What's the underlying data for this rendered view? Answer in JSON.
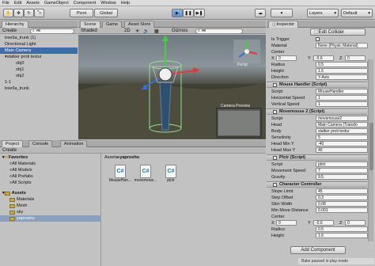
{
  "menu": [
    "File",
    "Edit",
    "Assets",
    "GameObject",
    "Component",
    "Window",
    "Help"
  ],
  "toolbar": {
    "pivot": "Pivot",
    "global": "Global",
    "layers": "Layers",
    "layout": "Default"
  },
  "hierarchy": {
    "tab": "Hierarchy",
    "create": "Create",
    "search": "All",
    "items": [
      "tree5a_trunk (1)",
      "Directional Light",
      "Main Camera",
      "stalker proti textur",
      "obj0",
      "obj1",
      "obj2",
      "1-1",
      "tree5a_trunk"
    ]
  },
  "scene": {
    "tab_scene": "Scene",
    "tab_game": "Game",
    "tab_asset": "Asset Store",
    "shaded": "Shaded",
    "mode2d": "2D",
    "gizmos": "Gizmos",
    "search": "All",
    "persp": "Persp",
    "preview_label": "Camera Preview"
  },
  "project": {
    "tab_project": "Project",
    "tab_console": "Console",
    "tab_animation": "Animation",
    "create": "Create",
    "favorites_label": "Favorites",
    "favorites": [
      "All Materials",
      "All Models",
      "All Prefabs",
      "All Scripts"
    ],
    "assets_label": "Assets",
    "folders": [
      "Materials",
      "Mesh",
      "sky",
      "yaproshu"
    ],
    "breadcrumb_root": "Assets",
    "breadcrumb_current": "yaproshu",
    "files": [
      "MouseHan...",
      "movemous...",
      "plctr"
    ]
  },
  "inspector": {
    "tab": "Inspector",
    "collider": {
      "edit_label": "Edit Collider",
      "is_trigger": "Is Trigger",
      "material_label": "Material",
      "material_value": "None (Physic Material)",
      "center_label": "Center",
      "x": "0",
      "y": "-0.6",
      "z": "0",
      "radius_label": "Radius",
      "radius": "0.5",
      "height_label": "Height",
      "height": "1.6",
      "direction_label": "Direction",
      "direction": "Y-Axis"
    },
    "mouse_handler": {
      "title": "Mouse Handler (Script)",
      "script_label": "Script",
      "script": "MouseHandler",
      "hspeed_label": "Horizontal Speed",
      "hspeed": "1",
      "vspeed_label": "Vertical Speed",
      "vspeed": "1"
    },
    "movemouse": {
      "title": "Movemouse 2 (Script)",
      "script_label": "Script",
      "script": "movemouse2",
      "head_label": "Head",
      "head": "Main Camera (Transfo",
      "body_label": "Body",
      "body": "stalker proti textur",
      "sens_label": "Sensitivity",
      "sens": "5",
      "hminy_label": "Head Min Y",
      "hminy": "-40",
      "hmaxy_label": "Head Max Y",
      "hmaxy": "40"
    },
    "plctr": {
      "title": "Plctr (Script)",
      "script_label": "Script",
      "script": "plctr",
      "move_label": "Movement Speed",
      "move": "7",
      "grav_label": "Gravity",
      "grav": "9.5"
    },
    "cc": {
      "title": "Character Controller",
      "slope_label": "Slope Limit",
      "slope": "45",
      "step_label": "Step Offset",
      "step": "0.3",
      "skin_label": "Skin Width",
      "skin": "0.08",
      "minmove_label": "Min Move Distance",
      "minmove": "0.001",
      "center_label": "Center",
      "x": "0",
      "y": "-0.6",
      "z": "0",
      "radius_label": "Radius",
      "radius": "0.5",
      "height_label": "Height",
      "height": "1.6"
    },
    "add_component": "Add Component",
    "status": "Bake paused in play mode"
  },
  "colors": {
    "selection": "#3d6ea8",
    "panel": "#c2c2c2"
  }
}
